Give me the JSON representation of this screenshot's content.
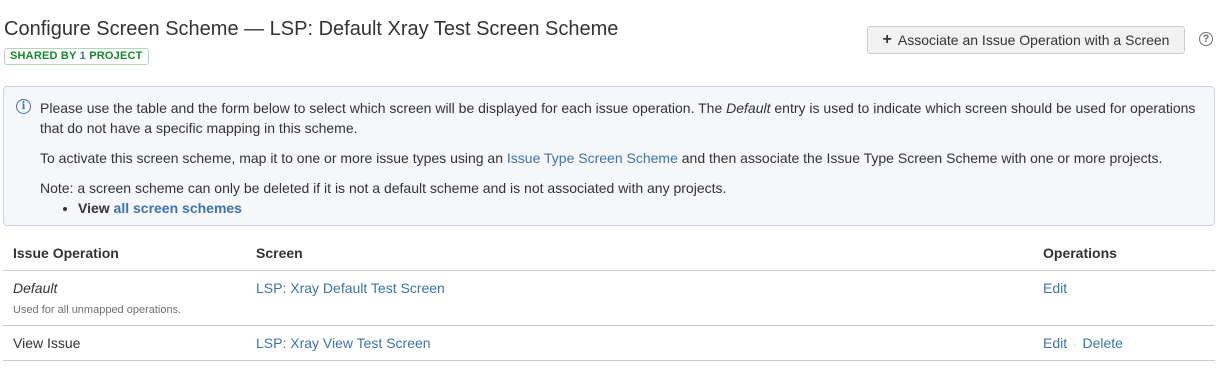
{
  "header": {
    "title": "Configure Screen Scheme — LSP: Default Xray Test Screen Scheme",
    "shared_prefix": "SHARED BY ",
    "shared_count": "1",
    "shared_suffix": " PROJECT",
    "associate_button_label": "Associate an Issue Operation with a Screen",
    "help_icon_glyph": "?"
  },
  "info": {
    "p1_before": "Please use the table and the form below to select which screen will be displayed for each issue operation. The ",
    "p1_em": "Default",
    "p1_after": " entry is used to indicate which screen should be used for operations that do not have a specific mapping in this scheme.",
    "p2_before": "To activate this screen scheme, map it to one or more issue types using an ",
    "p2_link": "Issue Type Screen Scheme",
    "p2_after": " and then associate the Issue Type Screen Scheme with one or more projects.",
    "p3": "Note: a screen scheme can only be deleted if it is not a default scheme and is not associated with any projects.",
    "view_prefix": "View ",
    "view_link": "all screen schemes"
  },
  "table": {
    "headers": {
      "operation": "Issue Operation",
      "screen": "Screen",
      "operations": "Operations"
    },
    "rows": [
      {
        "operation": "Default",
        "description": "Used for all unmapped operations.",
        "screen": "LSP: Xray Default Test Screen",
        "edit": "Edit"
      },
      {
        "operation": "View Issue",
        "screen": "LSP: Xray View Test Screen",
        "edit": "Edit",
        "separator": "·",
        "delete": "Delete"
      }
    ]
  },
  "colors": {
    "link": "#3b73af",
    "badge_green": "#14892c",
    "info_bg": "#f5f7fa",
    "info_border": "#ccd5e1"
  }
}
